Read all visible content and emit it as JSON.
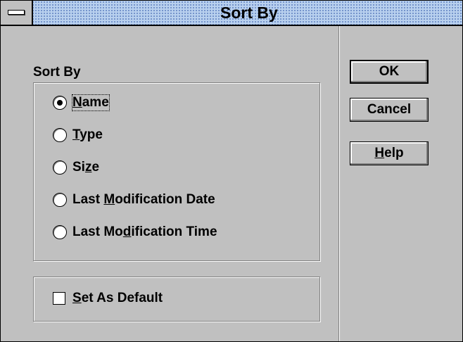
{
  "window": {
    "title": "Sort By",
    "system_menu_icon": "system-menu-bar-icon"
  },
  "group": {
    "label": "Sort By",
    "options": [
      {
        "before": "",
        "key": "N",
        "after": "ame",
        "selected": true
      },
      {
        "before": "",
        "key": "T",
        "after": "ype",
        "selected": false
      },
      {
        "before": "Si",
        "key": "z",
        "after": "e",
        "selected": false
      },
      {
        "before": "Last ",
        "key": "M",
        "after": "odification Date",
        "selected": false
      },
      {
        "before": "Last Mo",
        "key": "d",
        "after": "ification Time",
        "selected": false
      }
    ]
  },
  "default_checkbox": {
    "before": "",
    "key": "S",
    "after": "et As Default",
    "checked": false
  },
  "buttons": {
    "ok": "OK",
    "cancel": "Cancel",
    "help": {
      "before": "",
      "key": "H",
      "after": "elp"
    }
  },
  "colors": {
    "face": "#c0c0c0",
    "title_bg": "#b8d0ee"
  }
}
